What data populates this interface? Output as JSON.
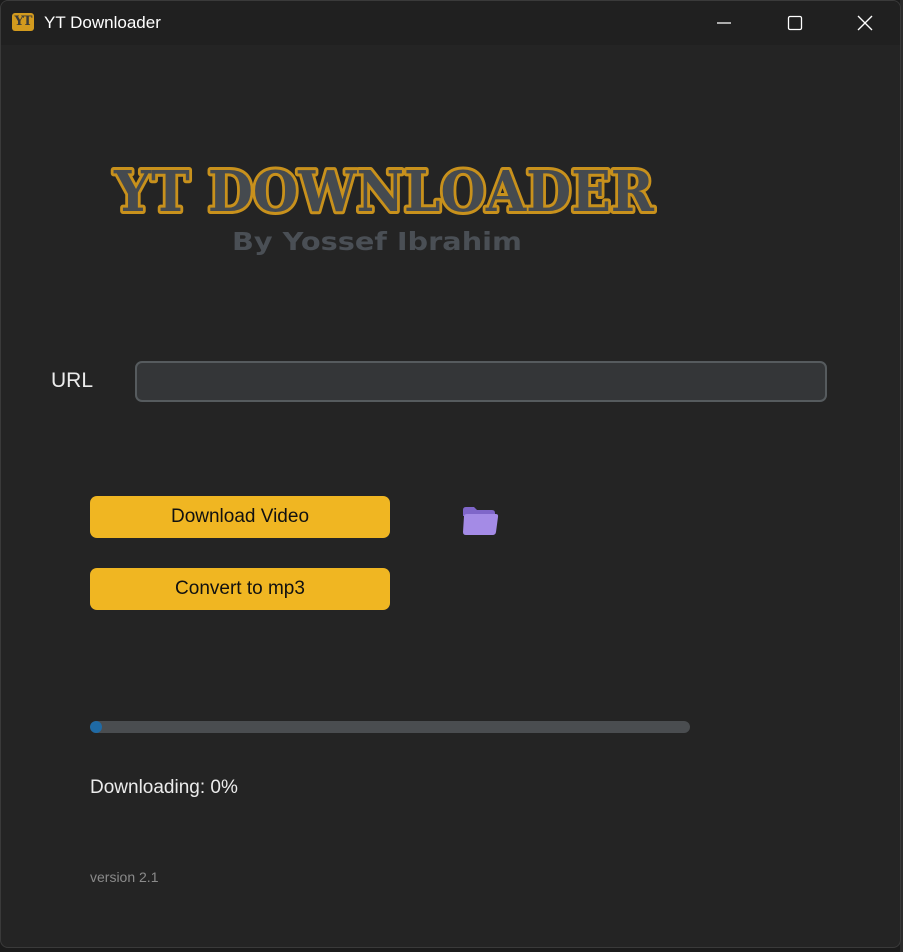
{
  "window": {
    "title": "YT Downloader",
    "icon_text": "YT",
    "controls": [
      "minimize-icon",
      "maximize-icon",
      "close-icon"
    ]
  },
  "logo": {
    "title": "YT DOWNLOADER",
    "subtitle": "By Yossef Ibrahim",
    "colors": {
      "fill": "#454a4f",
      "outline": "#c8911c",
      "subtitle": "#4a4f55"
    }
  },
  "form": {
    "url_label": "URL",
    "url_value": "",
    "url_placeholder": ""
  },
  "buttons": {
    "download_video": "Download Video",
    "convert_mp3": "Convert to mp3",
    "folder_icon": "folder-icon"
  },
  "progress": {
    "value_fraction": 0,
    "status_text": "Downloading: 0%"
  },
  "footer": {
    "version": "version 2.1"
  },
  "colors": {
    "background": "#242424",
    "titlebar": "#202020",
    "accent_button": "#f0b622",
    "progress_fill": "#1f6aa5",
    "progress_track": "#4a4d50",
    "folder": "#a48be6"
  }
}
